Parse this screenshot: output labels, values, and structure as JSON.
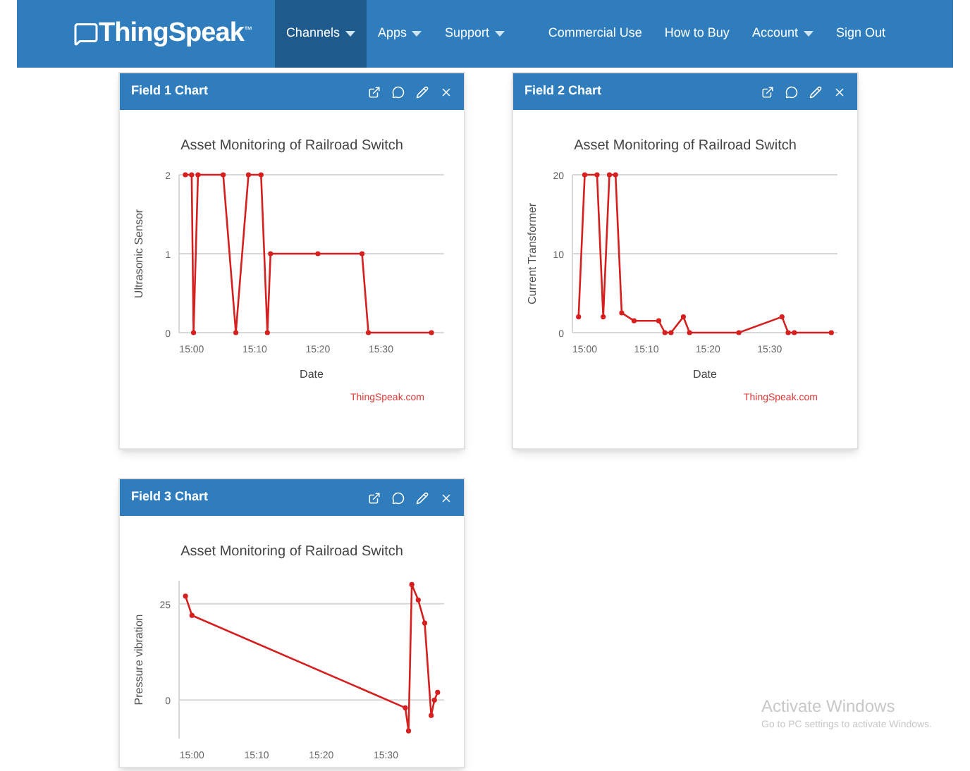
{
  "navbar": {
    "brand": "ThingSpeak",
    "trademark": "™",
    "menu": [
      {
        "label": "Channels",
        "dropdown": true,
        "selected": true
      },
      {
        "label": "Apps",
        "dropdown": true,
        "selected": false
      },
      {
        "label": "Support",
        "dropdown": true,
        "selected": false
      }
    ],
    "right_menu": [
      {
        "label": "Commercial Use",
        "dropdown": false
      },
      {
        "label": "How to Buy",
        "dropdown": false
      },
      {
        "label": "Account",
        "dropdown": true
      },
      {
        "label": "Sign Out",
        "dropdown": false
      }
    ]
  },
  "charts": [
    {
      "title": "Field 1 Chart",
      "credit": "ThingSpeak.com",
      "chart_data": {
        "type": "line",
        "title": "Asset Monitoring of Railroad Switch",
        "xlabel": "Date",
        "ylabel": "Ultrasonic Sensor",
        "x": [
          14.9833,
          15,
          15.005,
          15.0167,
          15.0833,
          15.1167,
          15.15,
          15.1833,
          15.2,
          15.2083,
          15.3333,
          15.45,
          15.4667,
          15.6333
        ],
        "series": [
          {
            "color": "#d62020",
            "marker": true,
            "values": [
              2,
              2,
              0,
              2,
              2,
              0,
              2,
              2,
              0,
              1,
              1,
              1,
              0,
              0
            ]
          }
        ],
        "xlim": [
          14.9667,
          15.6667
        ],
        "ylim": [
          0,
          2
        ],
        "xticks": [
          {
            "value": 15,
            "label": "15:00"
          },
          {
            "value": 15.1667,
            "label": "15:10"
          },
          {
            "value": 15.3333,
            "label": "15:20"
          },
          {
            "value": 15.5,
            "label": "15:30"
          }
        ],
        "yticks": [
          0,
          1,
          2
        ]
      }
    },
    {
      "title": "Field 2 Chart",
      "credit": "ThingSpeak.com",
      "chart_data": {
        "type": "line",
        "title": "Asset Monitoring of Railroad Switch",
        "xlabel": "Date",
        "ylabel": "Current Transformer",
        "x": [
          14.9833,
          15,
          15.0333,
          15.05,
          15.0667,
          15.0833,
          15.1,
          15.1333,
          15.2,
          15.2167,
          15.2333,
          15.2667,
          15.2833,
          15.4167,
          15.5333,
          15.55,
          15.5667,
          15.6667
        ],
        "series": [
          {
            "color": "#d62020",
            "marker": true,
            "values": [
              2,
              20,
              20,
              2,
              20,
              20,
              2.5,
              1.5,
              1.5,
              0,
              0,
              2,
              0,
              0,
              2,
              0,
              0,
              0
            ]
          }
        ],
        "xlim": [
          14.9667,
          15.6833
        ],
        "ylim": [
          0,
          20
        ],
        "xticks": [
          {
            "value": 15,
            "label": "15:00"
          },
          {
            "value": 15.1667,
            "label": "15:10"
          },
          {
            "value": 15.3333,
            "label": "15:20"
          },
          {
            "value": 15.5,
            "label": "15:30"
          }
        ],
        "yticks": [
          0,
          10,
          20
        ]
      }
    },
    {
      "title": "Field 3 Chart",
      "chart_data": {
        "type": "line",
        "title": "Asset Monitoring of Railroad Switch",
        "ylabel": "Pressure vibration",
        "x": [
          14.9833,
          15,
          15.55,
          15.5583,
          15.5667,
          15.5833,
          15.6,
          15.6167,
          15.625,
          15.6333
        ],
        "series": [
          {
            "color": "#d62020",
            "marker": true,
            "values": [
              27,
              22,
              -2,
              -8,
              30,
              26,
              20,
              -4,
              0,
              2
            ]
          }
        ],
        "xlim": [
          14.9667,
          15.65
        ],
        "ylim": [
          -10,
          31
        ],
        "xticks": [
          {
            "value": 15,
            "label": "15:00"
          },
          {
            "value": 15.1667,
            "label": "15:10"
          },
          {
            "value": 15.3333,
            "label": "15:20"
          },
          {
            "value": 15.5,
            "label": "15:30"
          }
        ],
        "yticks": [
          0,
          25
        ]
      }
    }
  ],
  "os_notice": {
    "title": "Activate Windows",
    "message": "Go to PC settings to activate Windows."
  }
}
